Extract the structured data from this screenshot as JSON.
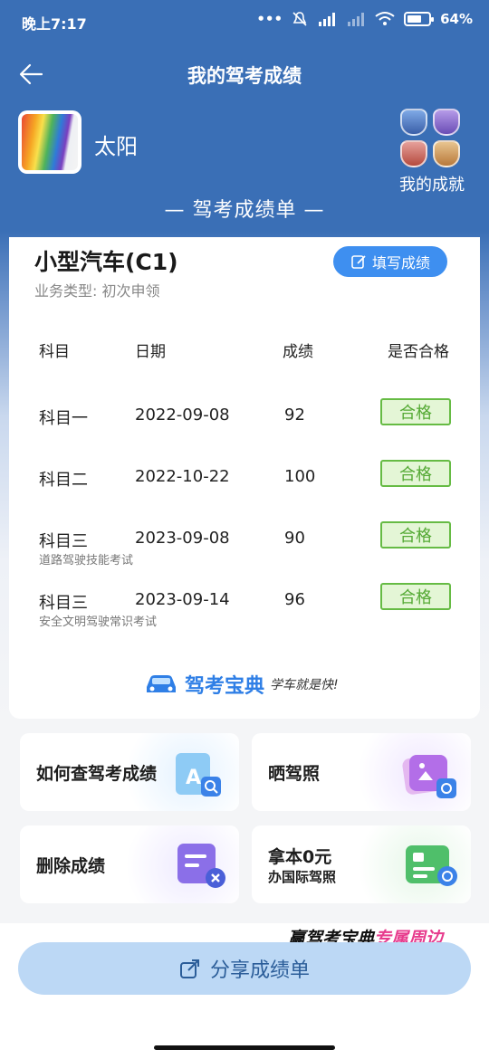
{
  "status": {
    "time": "晚上7:17",
    "battery": "64"
  },
  "nav": {
    "title": "我的驾考成绩"
  },
  "user": {
    "name": "太阳"
  },
  "achievements": {
    "label": "我的成就"
  },
  "sheet": {
    "title": "— 驾考成绩单 —"
  },
  "card": {
    "license": "小型汽车(C1)",
    "business_type": "业务类型: 初次申领",
    "fill_button": "填写成绩",
    "headers": [
      "科目",
      "日期",
      "成绩",
      "是否合格"
    ],
    "rows": [
      {
        "subject": "科目一",
        "date": "2022-09-08",
        "score": "92",
        "result": "合格",
        "note": ""
      },
      {
        "subject": "科目二",
        "date": "2022-10-22",
        "score": "100",
        "result": "合格",
        "note": ""
      },
      {
        "subject": "科目三",
        "date": "2023-09-08",
        "score": "90",
        "result": "合格",
        "note": "道路驾驶技能考试"
      },
      {
        "subject": "科目三",
        "date": "2023-09-14",
        "score": "96",
        "result": "合格",
        "note": "安全文明驾驶常识考试"
      }
    ],
    "brand_name": "驾考宝典",
    "brand_slogan": "学车就是快!"
  },
  "tiles": {
    "query": "如何查驾考成绩",
    "show_license": "晒驾照",
    "delete": "删除成绩",
    "intl_title": "拿本0元",
    "intl_sub": "办国际驾照"
  },
  "promo": {
    "prefix": "赢驾考宝典",
    "highlight": "专属周边"
  },
  "share": {
    "label": "分享成绩单"
  },
  "colors": {
    "header_blue": "#3a6fb6",
    "accent_blue": "#3e8ff0",
    "pass_green": "#54a934"
  }
}
